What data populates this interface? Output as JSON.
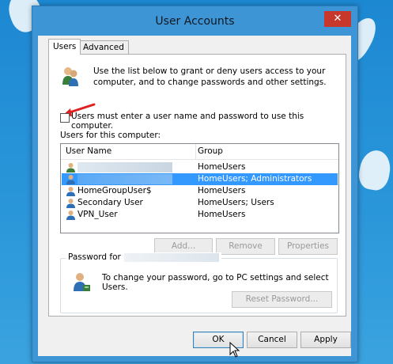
{
  "window": {
    "title": "User Accounts",
    "close_glyph": "✕"
  },
  "tabs": [
    {
      "label": "Users",
      "active": true
    },
    {
      "label": "Advanced",
      "active": false
    }
  ],
  "intro_text": "Use the list below to grant or deny users access to your computer, and to change passwords and other settings.",
  "checkbox": {
    "label": "Users must enter a user name and password to use this computer.",
    "checked": false
  },
  "users_label": "Users for this computer:",
  "table": {
    "columns": [
      "User Name",
      "Group"
    ],
    "rows": [
      {
        "name": "",
        "group": "HomeUsers",
        "redacted": true,
        "selected": false
      },
      {
        "name": "",
        "group": "HomeUsers; Administrators",
        "redacted": true,
        "selected": true
      },
      {
        "name": "HomeGroupUser$",
        "group": "HomeUsers",
        "redacted": false,
        "selected": false
      },
      {
        "name": "Secondary User",
        "group": "HomeUsers; Users",
        "redacted": false,
        "selected": false
      },
      {
        "name": "VPN_User",
        "group": "HomeUsers",
        "redacted": false,
        "selected": false
      }
    ]
  },
  "list_buttons": {
    "add": "Add...",
    "remove": "Remove",
    "properties": "Properties"
  },
  "password_group": {
    "legend": "Password for",
    "text": "To change your password, go to PC settings and select Users.",
    "reset_button": "Reset Password..."
  },
  "footer_buttons": {
    "ok": "OK",
    "cancel": "Cancel",
    "apply": "Apply"
  },
  "colors": {
    "accent": "#3d95d6",
    "selection": "#3399ff",
    "close": "#c7372c",
    "arrow": "#e02020"
  }
}
